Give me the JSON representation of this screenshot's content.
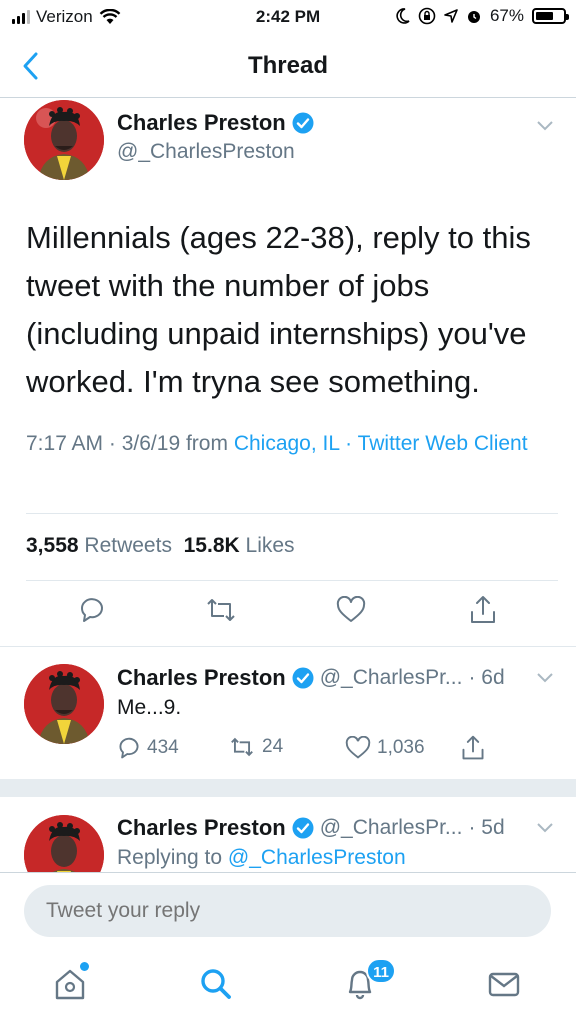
{
  "status_bar": {
    "carrier": "Verizon",
    "time": "2:42 PM",
    "battery": "67%",
    "battery_level": 0.67
  },
  "nav": {
    "title": "Thread"
  },
  "main_tweet": {
    "name": "Charles Preston",
    "handle": "@_CharlesPreston",
    "text": "Millennials (ages 22-38), reply to this tweet with the number of jobs (including unpaid internships) you've worked. I'm tryna see something.",
    "meta": {
      "time": "7:17 AM",
      "date": "3/6/19",
      "from_label": "from",
      "location": "Chicago, IL",
      "source": "Twitter Web Client"
    },
    "stats": {
      "retweets_count": "3,558",
      "retweets_label": "Retweets",
      "likes_count": "15.8K",
      "likes_label": "Likes"
    }
  },
  "replies": [
    {
      "name": "Charles Preston",
      "handle": "@_CharlesPr...",
      "age": "· 6d",
      "text": "Me...9.",
      "replies": "434",
      "retweets": "24",
      "likes": "1,036"
    },
    {
      "name": "Charles Preston",
      "handle": "@_CharlesPr...",
      "age": "· 5d",
      "replying_label": "Replying to",
      "replying_to": "@_CharlesPreston"
    }
  ],
  "reply_box": {
    "placeholder": "Tweet your reply"
  },
  "tab_bar": {
    "notifications_badge": "11"
  },
  "colors": {
    "accent": "#1da1f2",
    "secondary_text": "#657786",
    "divider": "#e1e8ed"
  },
  "icons": [
    "signal-icon",
    "wifi-icon",
    "moon-icon",
    "lock-rotation-icon",
    "location-icon",
    "alarm-icon",
    "battery-icon",
    "back-chevron-icon",
    "verified-badge-icon",
    "chevron-down-icon",
    "reply-icon",
    "retweet-icon",
    "like-icon",
    "share-icon",
    "home-icon",
    "search-icon",
    "notifications-icon",
    "messages-icon"
  ]
}
